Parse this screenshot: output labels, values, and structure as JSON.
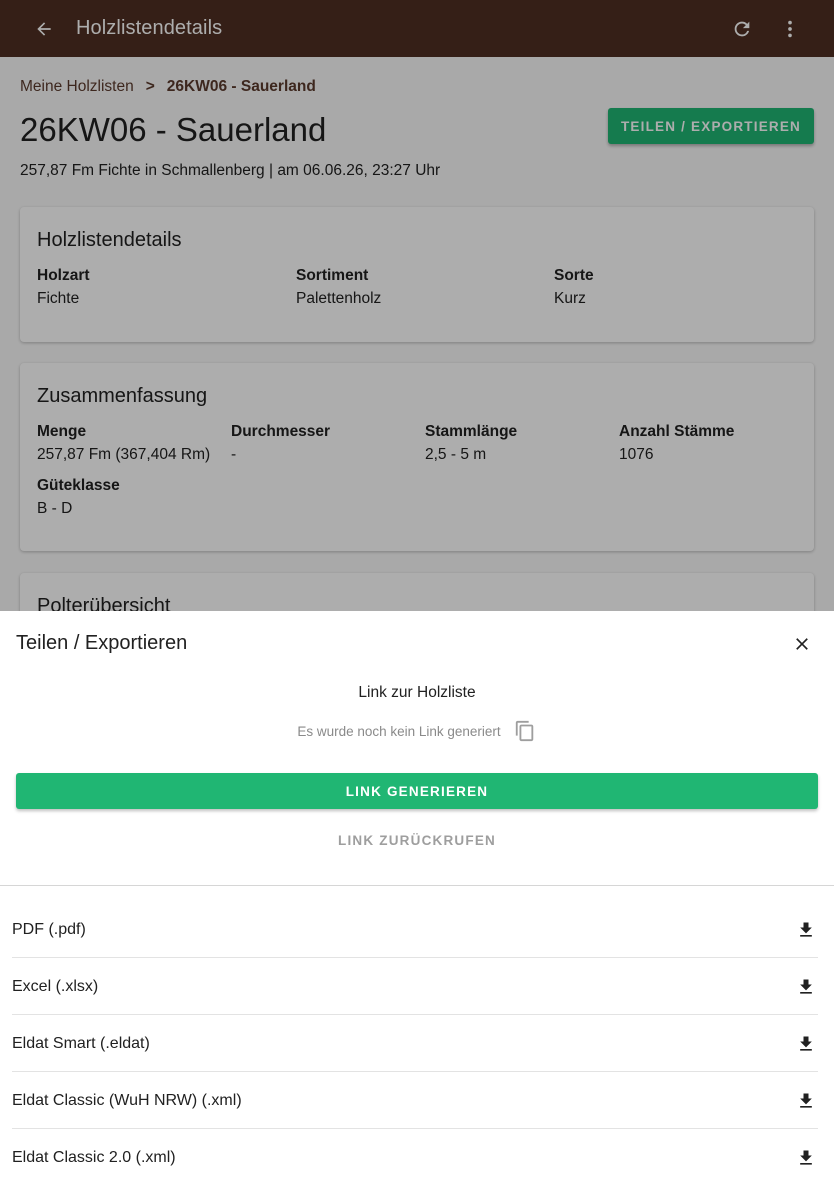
{
  "appbar": {
    "title": "Holzlistendetails",
    "icons": [
      "arrow-back-icon",
      "refresh-icon",
      "more-vert-icon"
    ],
    "background_color": "#4e2f22"
  },
  "breadcrumb": {
    "parent": "Meine Holzlisten",
    "separator": ">",
    "current": "26KW06 - Sauerland"
  },
  "page": {
    "title": "26KW06 - Sauerland",
    "subtitle": "257,87 Fm Fichte in Schmallenberg | am 06.06.26, 23:27 Uhr",
    "share_button": "TEILEN / EXPORTIEREN"
  },
  "details_card": {
    "title": "Holzlistendetails",
    "fields": [
      {
        "label": "Holzart",
        "value": "Fichte"
      },
      {
        "label": "Sortiment",
        "value": "Palettenholz"
      },
      {
        "label": "Sorte",
        "value": "Kurz"
      }
    ]
  },
  "summary_card": {
    "title": "Zusammenfassung",
    "fields": [
      {
        "label": "Menge",
        "value": "257,87 Fm (367,404 Rm)"
      },
      {
        "label": "Durchmesser",
        "value": "-"
      },
      {
        "label": "Stammlänge",
        "value": "2,5 - 5 m"
      },
      {
        "label": "Anzahl Stämme",
        "value": "1076"
      },
      {
        "label": "Güteklasse",
        "value": "B - D"
      }
    ]
  },
  "polter_card": {
    "title": "Polterübersicht"
  },
  "sheet": {
    "title": "Teilen / Exportieren",
    "link_heading": "Link zur Holzliste",
    "link_placeholder": "Es wurde noch kein Link generiert",
    "generate_button": "LINK GENERIEREN",
    "revoke_button": "LINK ZURÜCKRUFEN",
    "exports": [
      {
        "label": "PDF (.pdf)",
        "icon": "download-icon"
      },
      {
        "label": "Excel (.xlsx)",
        "icon": "download-icon"
      },
      {
        "label": "Eldat Smart (.eldat)",
        "icon": "download-icon"
      },
      {
        "label": "Eldat Classic (WuH NRW) (.xml)",
        "icon": "download-icon"
      },
      {
        "label": "Eldat Classic 2.0 (.xml)",
        "icon": "download-icon"
      }
    ]
  },
  "colors": {
    "accent_green": "#20b673",
    "brand_brown": "#4e2f22"
  }
}
